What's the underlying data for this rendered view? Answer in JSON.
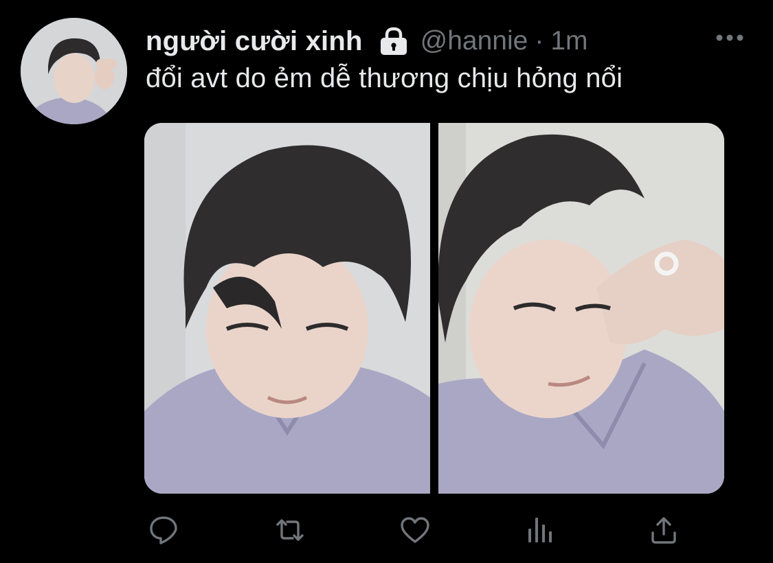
{
  "tweet": {
    "display_name": "người cười xinh",
    "handle": "@hannie",
    "separator": "·",
    "time": "1m",
    "text": "đổi avt do ẻm dễ thương chịu hỏng nổi",
    "protected": true,
    "icons": {
      "lock": "lock-icon",
      "more": "more-icon"
    }
  },
  "media": {
    "count": 2,
    "items": [
      {
        "kind": "photo"
      },
      {
        "kind": "photo"
      }
    ]
  },
  "actions": [
    {
      "icon": "reply-icon"
    },
    {
      "icon": "retweet-icon"
    },
    {
      "icon": "like-icon"
    },
    {
      "icon": "analytics-icon"
    },
    {
      "icon": "share-icon"
    }
  ],
  "colors": {
    "background": "#000000",
    "primary_text": "#e7e9ea",
    "secondary_text": "#71767b",
    "shirt": "#a9a7c4",
    "wall": "#d9dadc"
  }
}
